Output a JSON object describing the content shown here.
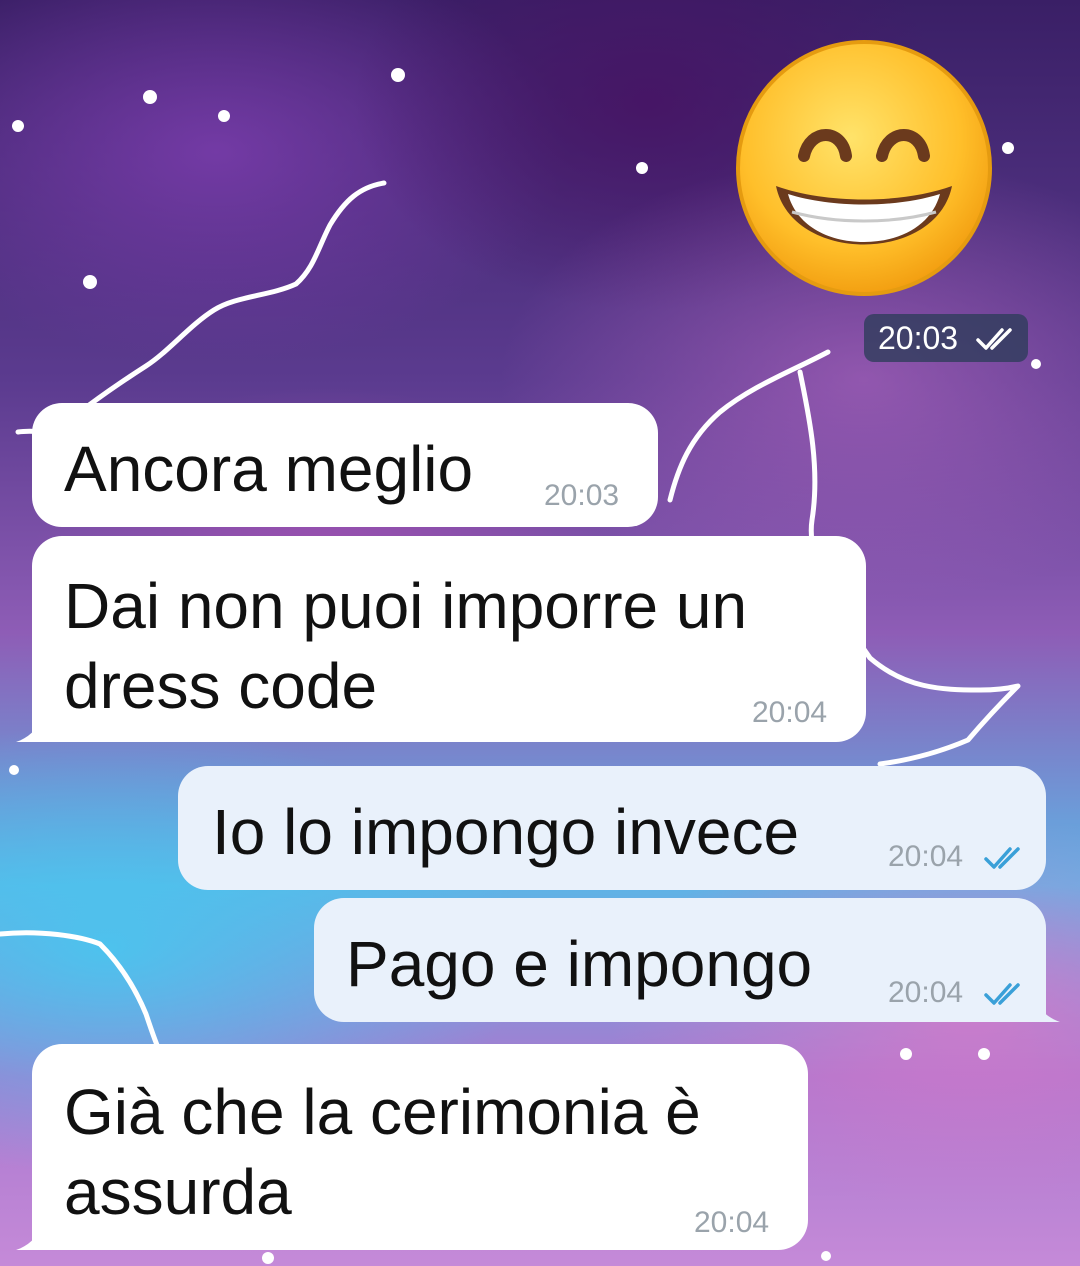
{
  "theme": {
    "incoming_bubble": "#ffffff",
    "outgoing_bubble": "#e9f1fb",
    "time_color": "#9aa3ab",
    "tick_color": "#3aa0d8"
  },
  "sticker": {
    "icon": "grinning-face-emoji-icon",
    "time": "20:03",
    "status": "read"
  },
  "messages": [
    {
      "direction": "incoming",
      "text_lines": [
        "Ancora meglio"
      ],
      "time": "20:03"
    },
    {
      "direction": "incoming",
      "text_lines": [
        "Dai non puoi imporre un",
        "dress code"
      ],
      "time": "20:04"
    },
    {
      "direction": "outgoing",
      "text_lines": [
        "Io lo impongo invece"
      ],
      "time": "20:04",
      "status": "read"
    },
    {
      "direction": "outgoing",
      "text_lines": [
        "Pago e impongo"
      ],
      "time": "20:04",
      "status": "read"
    },
    {
      "direction": "incoming",
      "text_lines": [
        "Già che la cerimonia è",
        "assurda"
      ],
      "time": "20:04"
    }
  ]
}
